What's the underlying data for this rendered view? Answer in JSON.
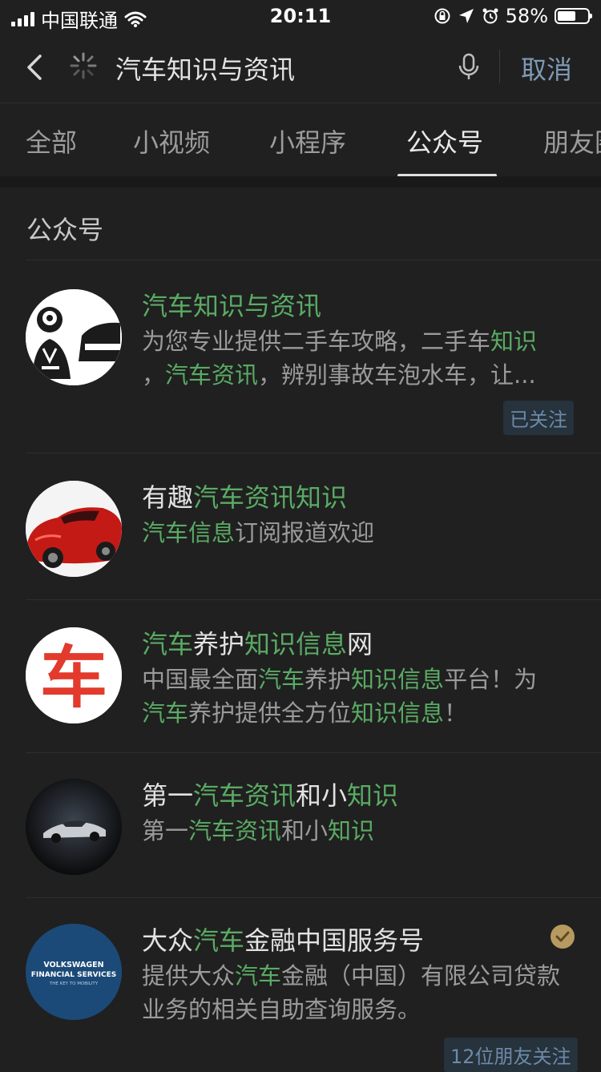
{
  "status": {
    "carrier": "中国联通",
    "time": "20:11",
    "battery": "58%",
    "battery_level": 0.58
  },
  "search": {
    "query": "汽车知识与资讯",
    "cancel": "取消"
  },
  "tabs": [
    "全部",
    "小视频",
    "小程序",
    "公众号",
    "朋友圈"
  ],
  "active_tab": "公众号",
  "section_title": "公众号",
  "results": [
    {
      "title": [
        {
          "t": "汽车知识与资讯",
          "hl": true
        }
      ],
      "desc": [
        {
          "t": "为您专业提供二手车攻略，二手车",
          "hl": false
        },
        {
          "t": "知识",
          "hl": true
        },
        {
          "t": "，",
          "hl": false
        },
        {
          "t": "汽车资讯",
          "hl": true
        },
        {
          "t": "，辨别事故车泡水车，让...",
          "hl": false
        }
      ],
      "badge": "已关注",
      "avatar_icon": "mechanic-car-icon"
    },
    {
      "title": [
        {
          "t": "有趣",
          "hl": false
        },
        {
          "t": "汽车资讯知识",
          "hl": true
        }
      ],
      "desc": [
        {
          "t": "汽车信息",
          "hl": true
        },
        {
          "t": "订阅报道欢迎",
          "hl": false
        }
      ],
      "avatar_icon": "red-sports-car-photo"
    },
    {
      "title": [
        {
          "t": "汽车",
          "hl": true
        },
        {
          "t": "养护",
          "hl": false
        },
        {
          "t": "知识信息",
          "hl": true
        },
        {
          "t": "网",
          "hl": false
        }
      ],
      "desc": [
        {
          "t": "中国最全面",
          "hl": false
        },
        {
          "t": "汽车",
          "hl": true
        },
        {
          "t": "养护",
          "hl": false
        },
        {
          "t": "知识信息",
          "hl": true
        },
        {
          "t": "平台！为",
          "hl": false
        },
        {
          "t": "汽车",
          "hl": true
        },
        {
          "t": "养护提供全方位",
          "hl": false
        },
        {
          "t": "知识信息",
          "hl": true
        },
        {
          "t": "！",
          "hl": false
        }
      ],
      "avatar_text": "车"
    },
    {
      "title": [
        {
          "t": "第一",
          "hl": false
        },
        {
          "t": "汽车资讯",
          "hl": true
        },
        {
          "t": "和小",
          "hl": false
        },
        {
          "t": "知识",
          "hl": true
        }
      ],
      "desc": [
        {
          "t": "第一",
          "hl": false
        },
        {
          "t": "汽车资讯",
          "hl": true
        },
        {
          "t": "和小",
          "hl": false
        },
        {
          "t": "知识",
          "hl": true
        }
      ],
      "avatar_icon": "silver-sports-car-photo"
    },
    {
      "title": [
        {
          "t": "大众",
          "hl": false
        },
        {
          "t": "汽车",
          "hl": true
        },
        {
          "t": "金融中国服务号",
          "hl": false
        }
      ],
      "desc": [
        {
          "t": "提供大众",
          "hl": false
        },
        {
          "t": "汽车",
          "hl": true
        },
        {
          "t": "金融（中国）有限公司贷款业务的相关自助查询服务。",
          "hl": false
        }
      ],
      "badge": "12位朋友关注",
      "verified_icon": "verified-check-icon",
      "avatar_text_lines": [
        "VOLKSWAGEN",
        "FINANCIAL SERVICES",
        "THE KEY TO MOBILITY"
      ]
    }
  ],
  "colors": {
    "background": "#202020",
    "highlight": "#5aab64",
    "link": "#7f9ab5"
  }
}
